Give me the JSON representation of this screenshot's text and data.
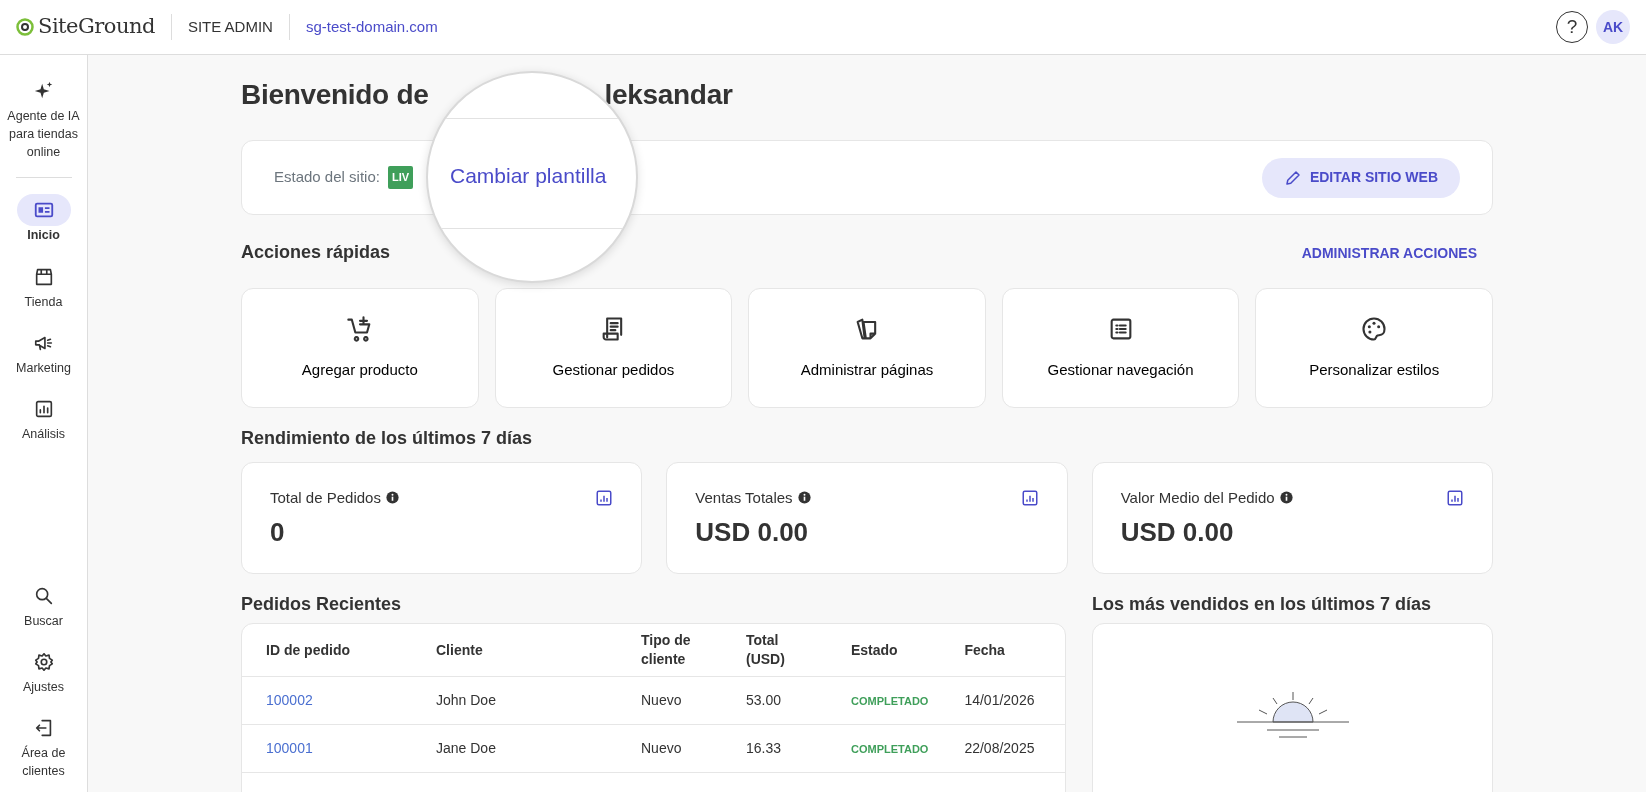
{
  "header": {
    "logo": "SiteGround",
    "section": "SITE ADMIN",
    "domain": "sg-test-domain.com",
    "help": "?",
    "avatar": "AK"
  },
  "sidebar": {
    "top_items": [
      {
        "label": "Agente de IA para tiendas online",
        "selected": false
      },
      {
        "label": "Inicio",
        "selected": true
      },
      {
        "label": "Tienda",
        "selected": false
      },
      {
        "label": "Marketing",
        "selected": false
      },
      {
        "label": "Análisis",
        "selected": false
      }
    ],
    "bottom_items": [
      {
        "label": "Buscar",
        "selected": false
      },
      {
        "label": "Ajustes",
        "selected": false
      },
      {
        "label": "Área de clientes",
        "selected": false
      }
    ]
  },
  "welcome": {
    "title_start": "Bienvenido de",
    "title_end": "leksandar"
  },
  "site_status": {
    "label": "Estado del sitio:",
    "badge": "LIV",
    "edit_button": "EDITAR SITIO WEB"
  },
  "magnifier": {
    "link": "Cambiar plantilla"
  },
  "quick_actions": {
    "title": "Acciones rápidas",
    "manage_link": "ADMINISTRAR ACCIONES",
    "items": [
      {
        "label": "Agregar producto"
      },
      {
        "label": "Gestionar pedidos"
      },
      {
        "label": "Administrar páginas"
      },
      {
        "label": "Gestionar navegación"
      },
      {
        "label": "Personalizar estilos"
      }
    ]
  },
  "performance": {
    "title": "Rendimiento de los últimos 7 días",
    "cards": [
      {
        "label": "Total de Pedidos",
        "value": "0"
      },
      {
        "label": "Ventas Totales",
        "value": "USD 0.00"
      },
      {
        "label": "Valor Medio del Pedido",
        "value": "USD 0.00"
      }
    ]
  },
  "recent_orders": {
    "title": "Pedidos Recientes",
    "columns": [
      "ID de pedido",
      "Cliente",
      "Tipo de cliente",
      "Total (USD)",
      "Estado",
      "Fecha"
    ],
    "rows": [
      {
        "id": "100002",
        "customer": "John Doe",
        "customer_type": "Nuevo",
        "total": "53.00",
        "status": "COMPLETADO",
        "date": "14/01/2026"
      },
      {
        "id": "100001",
        "customer": "Jane Doe",
        "customer_type": "Nuevo",
        "total": "16.33",
        "status": "COMPLETADO",
        "date": "22/08/2025"
      }
    ]
  },
  "best_sellers": {
    "title": "Los más vendidos en los últimos 7 días"
  }
}
